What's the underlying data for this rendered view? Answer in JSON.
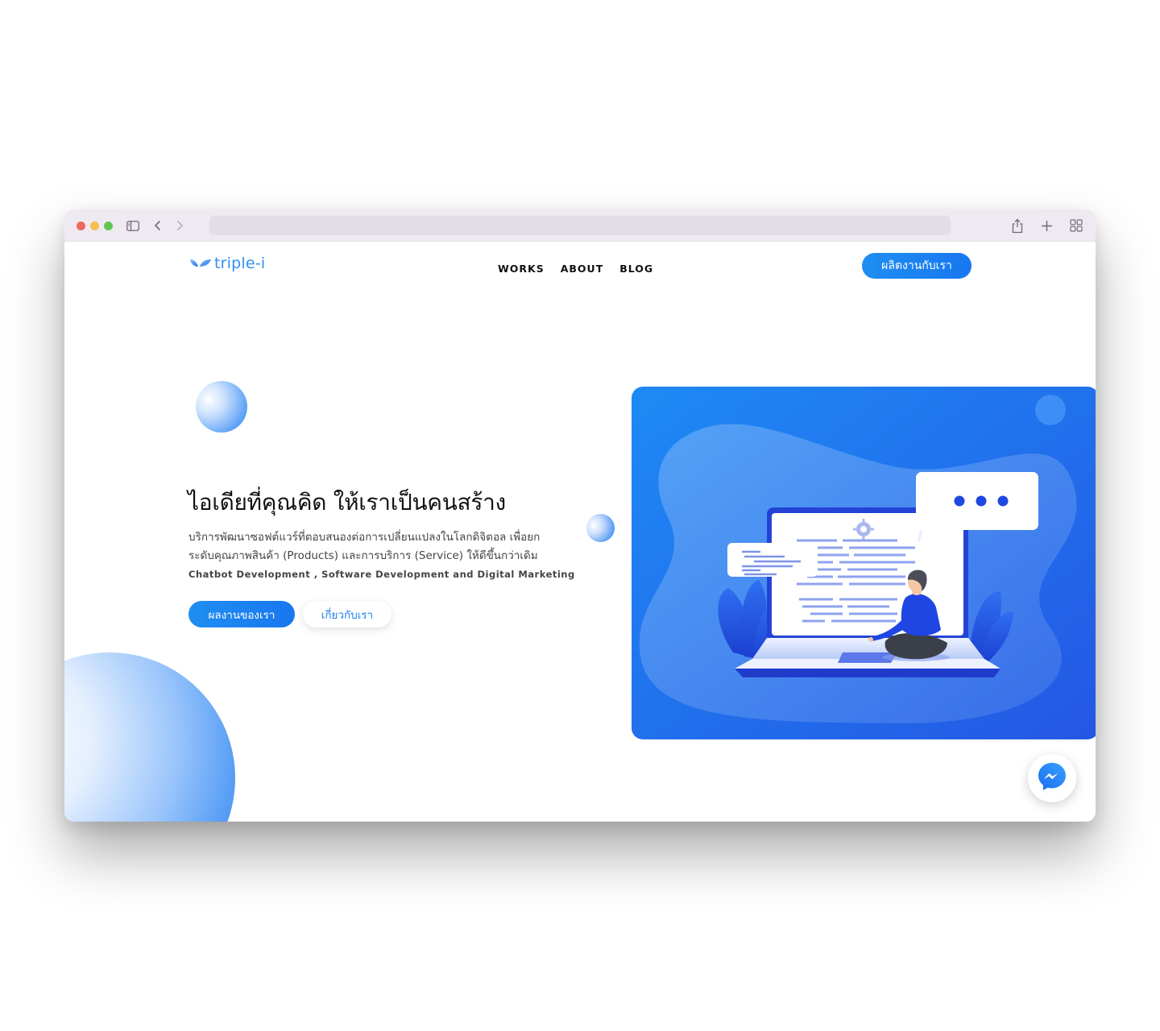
{
  "browser": {
    "icons": [
      "sidebar-icon",
      "back-icon",
      "forward-icon",
      "share-icon",
      "new-tab-icon",
      "tab-overview-icon"
    ]
  },
  "site": {
    "logo_text": "triple-i",
    "nav": [
      {
        "label": "WORKS"
      },
      {
        "label": "ABOUT"
      },
      {
        "label": "BLOG"
      }
    ],
    "contact_button": "ผลิตงานกับเรา"
  },
  "hero": {
    "title": "ไอเดียที่คุณคิด ให้เราเป็นคนสร้าง",
    "description_line1": "บริการพัฒนาซอฟต์แวร์ที่ตอบสนองต่อการเปลี่ยนแปลงในโลกดิจิตอล เพื่อยก",
    "description_line2": "ระดับคุณภาพสินค้า (Products) และการบริการ (Service) ให้ดีขึ้นกว่าเดิม",
    "subline": "Chatbot Development , Software Development and Digital Marketing",
    "primary_button": "ผลงานของเรา",
    "secondary_button": "เกี่ยวกับเรา"
  },
  "colors": {
    "brand_blue": "#1f8ef1",
    "illustration_blue": "#2a74f0"
  }
}
